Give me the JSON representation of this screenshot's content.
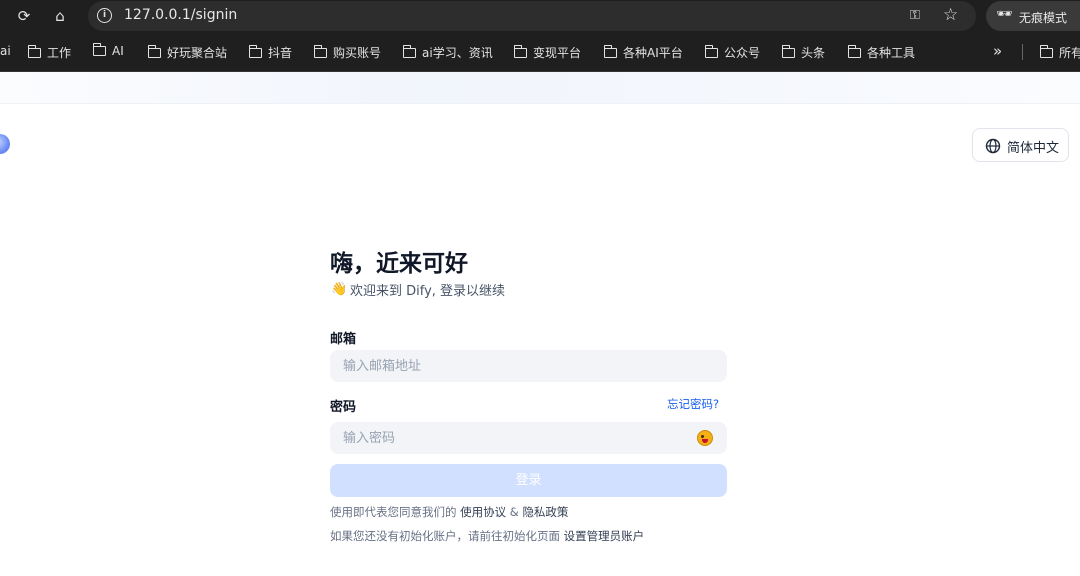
{
  "browser": {
    "url": "127.0.0.1/signin",
    "incognito_label": "无痕模式",
    "bookmarks": [
      "ai",
      "工作",
      "AI",
      "好玩聚合站",
      "抖音",
      "购买账号",
      "ai学习、资讯",
      "变现平台",
      "各种AI平台",
      "公众号",
      "头条",
      "各种工具"
    ],
    "more_label": "»",
    "all_bookmarks_label": "所有书签"
  },
  "lang": {
    "label": "简体中文"
  },
  "signin": {
    "title": "嗨，近来可好",
    "wave": "👋",
    "subtitle": "欢迎来到 Dify, 登录以继续",
    "email_label": "邮箱",
    "email_placeholder": "输入邮箱地址",
    "password_label": "密码",
    "forgot_label": "忘记密码?",
    "password_placeholder": "输入密码",
    "login_label": "登录",
    "terms_prefix": "使用即代表您同意我们的 ",
    "terms_link": "使用协议",
    "terms_and": " & ",
    "privacy_link": "隐私政策",
    "init_prefix": "如果您还没有初始化账户，请前往初始化页面 ",
    "init_link": "设置管理员账户"
  },
  "colors": {
    "accent": "#155eef",
    "button_disabled": "#d1e0ff",
    "input_bg": "#f2f4f7"
  }
}
